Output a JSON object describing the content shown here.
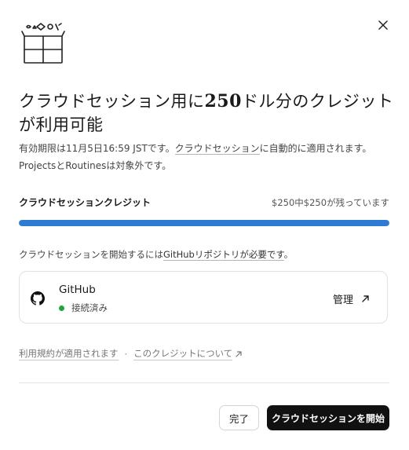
{
  "dialog": {
    "title_prefix": "クラウドセッション用に",
    "title_amount": "250",
    "title_suffix": "ドル分のクレジットが利用可能",
    "desc_part1": "有効期限は11月5日16:59 JSTです。",
    "desc_link": "クラウドセッション",
    "desc_part2": "に自動的に適用されます。",
    "desc_line2": "ProjectsとRoutinesは対象外です。",
    "credit_label": "クラウドセッションクレジット",
    "credit_remaining": "$250中$250が残っています",
    "credit_fraction": 1.0,
    "requirement_prefix": "クラウドセッションを開始するには",
    "requirement_link": "GitHubリポジトリが必要です",
    "requirement_suffix": "。",
    "github": {
      "name": "GitHub",
      "status": "接続済み",
      "status_color": "#1fa63a",
      "manage_label": "管理",
      "manage_icon": "arrow-up-right-icon"
    },
    "terms_link": "利用規約が適用されます",
    "separator": "·",
    "about_link": "このクレジットについて",
    "done_label": "完了",
    "start_label": "クラウドセッションを開始",
    "accent_color": "#2e7bd4",
    "icons": [
      "close-icon",
      "gift-box-icon",
      "github-icon",
      "external-link-icon"
    ]
  }
}
